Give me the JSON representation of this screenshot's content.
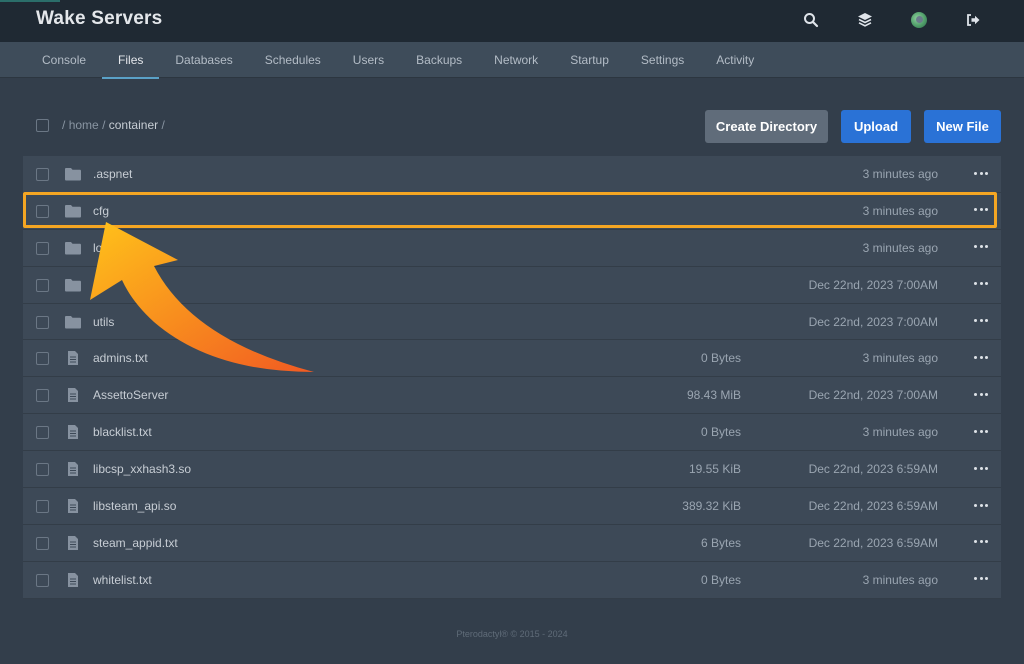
{
  "app": {
    "title": "Wake Servers"
  },
  "top_icons": [
    "search-icon",
    "layers-icon",
    "avatar",
    "logout-icon"
  ],
  "tabs": [
    {
      "label": "Console",
      "active": false
    },
    {
      "label": "Files",
      "active": true
    },
    {
      "label": "Databases",
      "active": false
    },
    {
      "label": "Schedules",
      "active": false
    },
    {
      "label": "Users",
      "active": false
    },
    {
      "label": "Backups",
      "active": false
    },
    {
      "label": "Network",
      "active": false
    },
    {
      "label": "Startup",
      "active": false
    },
    {
      "label": "Settings",
      "active": false
    },
    {
      "label": "Activity",
      "active": false
    }
  ],
  "breadcrumb": {
    "sep": "/",
    "home": "home",
    "current": "container"
  },
  "actions": {
    "create_directory": "Create Directory",
    "upload": "Upload",
    "new_file": "New File"
  },
  "files": [
    {
      "type": "folder",
      "name": ".aspnet",
      "size": "",
      "modified": "3 minutes ago"
    },
    {
      "type": "folder",
      "name": "cfg",
      "size": "",
      "modified": "3 minutes ago",
      "highlighted": true
    },
    {
      "type": "folder",
      "name": "lo",
      "size": "",
      "modified": "3 minutes ago"
    },
    {
      "type": "folder",
      "name": "",
      "size": "",
      "modified": "Dec 22nd, 2023 7:00AM"
    },
    {
      "type": "folder",
      "name": "utils",
      "size": "",
      "modified": "Dec 22nd, 2023 7:00AM"
    },
    {
      "type": "file",
      "name": "admins.txt",
      "size": "0 Bytes",
      "modified": "3 minutes ago"
    },
    {
      "type": "file",
      "name": "AssettoServer",
      "size": "98.43 MiB",
      "modified": "Dec 22nd, 2023 7:00AM"
    },
    {
      "type": "file",
      "name": "blacklist.txt",
      "size": "0 Bytes",
      "modified": "3 minutes ago"
    },
    {
      "type": "file",
      "name": "libcsp_xxhash3.so",
      "size": "19.55 KiB",
      "modified": "Dec 22nd, 2023 6:59AM"
    },
    {
      "type": "file",
      "name": "libsteam_api.so",
      "size": "389.32 KiB",
      "modified": "Dec 22nd, 2023 6:59AM"
    },
    {
      "type": "file",
      "name": "steam_appid.txt",
      "size": "6 Bytes",
      "modified": "Dec 22nd, 2023 6:59AM"
    },
    {
      "type": "file",
      "name": "whitelist.txt",
      "size": "0 Bytes",
      "modified": "3 minutes ago"
    }
  ],
  "footer": {
    "text": "Pterodactyl® © 2015 - 2024"
  },
  "colors": {
    "highlight": "#f5a623",
    "primary": "#2a72d6",
    "tab_underline": "#5aa1c7"
  }
}
